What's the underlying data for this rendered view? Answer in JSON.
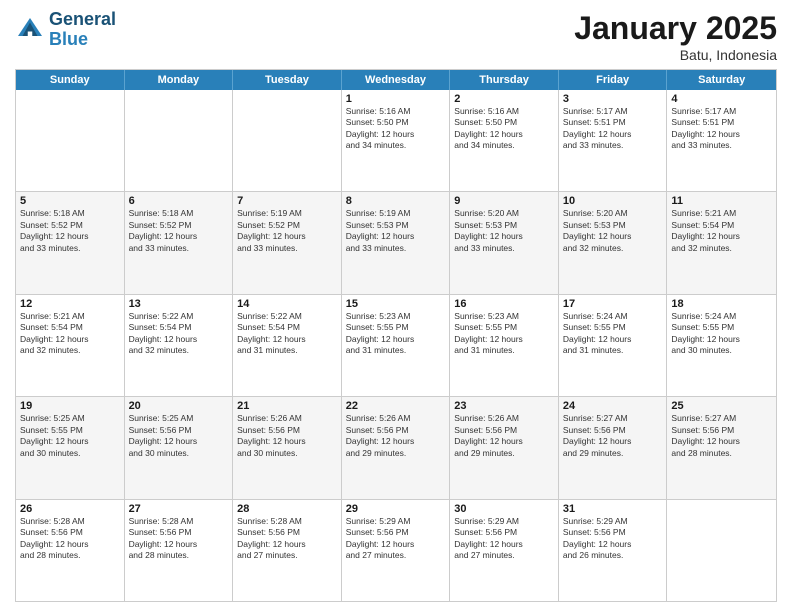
{
  "header": {
    "logo_line1": "General",
    "logo_line2": "Blue",
    "title": "January 2025",
    "subtitle": "Batu, Indonesia"
  },
  "days_of_week": [
    "Sunday",
    "Monday",
    "Tuesday",
    "Wednesday",
    "Thursday",
    "Friday",
    "Saturday"
  ],
  "weeks": [
    {
      "alt": false,
      "cells": [
        {
          "day": "",
          "info": ""
        },
        {
          "day": "",
          "info": ""
        },
        {
          "day": "",
          "info": ""
        },
        {
          "day": "1",
          "info": "Sunrise: 5:16 AM\nSunset: 5:50 PM\nDaylight: 12 hours\nand 34 minutes."
        },
        {
          "day": "2",
          "info": "Sunrise: 5:16 AM\nSunset: 5:50 PM\nDaylight: 12 hours\nand 34 minutes."
        },
        {
          "day": "3",
          "info": "Sunrise: 5:17 AM\nSunset: 5:51 PM\nDaylight: 12 hours\nand 33 minutes."
        },
        {
          "day": "4",
          "info": "Sunrise: 5:17 AM\nSunset: 5:51 PM\nDaylight: 12 hours\nand 33 minutes."
        }
      ]
    },
    {
      "alt": true,
      "cells": [
        {
          "day": "5",
          "info": "Sunrise: 5:18 AM\nSunset: 5:52 PM\nDaylight: 12 hours\nand 33 minutes."
        },
        {
          "day": "6",
          "info": "Sunrise: 5:18 AM\nSunset: 5:52 PM\nDaylight: 12 hours\nand 33 minutes."
        },
        {
          "day": "7",
          "info": "Sunrise: 5:19 AM\nSunset: 5:52 PM\nDaylight: 12 hours\nand 33 minutes."
        },
        {
          "day": "8",
          "info": "Sunrise: 5:19 AM\nSunset: 5:53 PM\nDaylight: 12 hours\nand 33 minutes."
        },
        {
          "day": "9",
          "info": "Sunrise: 5:20 AM\nSunset: 5:53 PM\nDaylight: 12 hours\nand 33 minutes."
        },
        {
          "day": "10",
          "info": "Sunrise: 5:20 AM\nSunset: 5:53 PM\nDaylight: 12 hours\nand 32 minutes."
        },
        {
          "day": "11",
          "info": "Sunrise: 5:21 AM\nSunset: 5:54 PM\nDaylight: 12 hours\nand 32 minutes."
        }
      ]
    },
    {
      "alt": false,
      "cells": [
        {
          "day": "12",
          "info": "Sunrise: 5:21 AM\nSunset: 5:54 PM\nDaylight: 12 hours\nand 32 minutes."
        },
        {
          "day": "13",
          "info": "Sunrise: 5:22 AM\nSunset: 5:54 PM\nDaylight: 12 hours\nand 32 minutes."
        },
        {
          "day": "14",
          "info": "Sunrise: 5:22 AM\nSunset: 5:54 PM\nDaylight: 12 hours\nand 31 minutes."
        },
        {
          "day": "15",
          "info": "Sunrise: 5:23 AM\nSunset: 5:55 PM\nDaylight: 12 hours\nand 31 minutes."
        },
        {
          "day": "16",
          "info": "Sunrise: 5:23 AM\nSunset: 5:55 PM\nDaylight: 12 hours\nand 31 minutes."
        },
        {
          "day": "17",
          "info": "Sunrise: 5:24 AM\nSunset: 5:55 PM\nDaylight: 12 hours\nand 31 minutes."
        },
        {
          "day": "18",
          "info": "Sunrise: 5:24 AM\nSunset: 5:55 PM\nDaylight: 12 hours\nand 30 minutes."
        }
      ]
    },
    {
      "alt": true,
      "cells": [
        {
          "day": "19",
          "info": "Sunrise: 5:25 AM\nSunset: 5:55 PM\nDaylight: 12 hours\nand 30 minutes."
        },
        {
          "day": "20",
          "info": "Sunrise: 5:25 AM\nSunset: 5:56 PM\nDaylight: 12 hours\nand 30 minutes."
        },
        {
          "day": "21",
          "info": "Sunrise: 5:26 AM\nSunset: 5:56 PM\nDaylight: 12 hours\nand 30 minutes."
        },
        {
          "day": "22",
          "info": "Sunrise: 5:26 AM\nSunset: 5:56 PM\nDaylight: 12 hours\nand 29 minutes."
        },
        {
          "day": "23",
          "info": "Sunrise: 5:26 AM\nSunset: 5:56 PM\nDaylight: 12 hours\nand 29 minutes."
        },
        {
          "day": "24",
          "info": "Sunrise: 5:27 AM\nSunset: 5:56 PM\nDaylight: 12 hours\nand 29 minutes."
        },
        {
          "day": "25",
          "info": "Sunrise: 5:27 AM\nSunset: 5:56 PM\nDaylight: 12 hours\nand 28 minutes."
        }
      ]
    },
    {
      "alt": false,
      "cells": [
        {
          "day": "26",
          "info": "Sunrise: 5:28 AM\nSunset: 5:56 PM\nDaylight: 12 hours\nand 28 minutes."
        },
        {
          "day": "27",
          "info": "Sunrise: 5:28 AM\nSunset: 5:56 PM\nDaylight: 12 hours\nand 28 minutes."
        },
        {
          "day": "28",
          "info": "Sunrise: 5:28 AM\nSunset: 5:56 PM\nDaylight: 12 hours\nand 27 minutes."
        },
        {
          "day": "29",
          "info": "Sunrise: 5:29 AM\nSunset: 5:56 PM\nDaylight: 12 hours\nand 27 minutes."
        },
        {
          "day": "30",
          "info": "Sunrise: 5:29 AM\nSunset: 5:56 PM\nDaylight: 12 hours\nand 27 minutes."
        },
        {
          "day": "31",
          "info": "Sunrise: 5:29 AM\nSunset: 5:56 PM\nDaylight: 12 hours\nand 26 minutes."
        },
        {
          "day": "",
          "info": ""
        }
      ]
    }
  ]
}
